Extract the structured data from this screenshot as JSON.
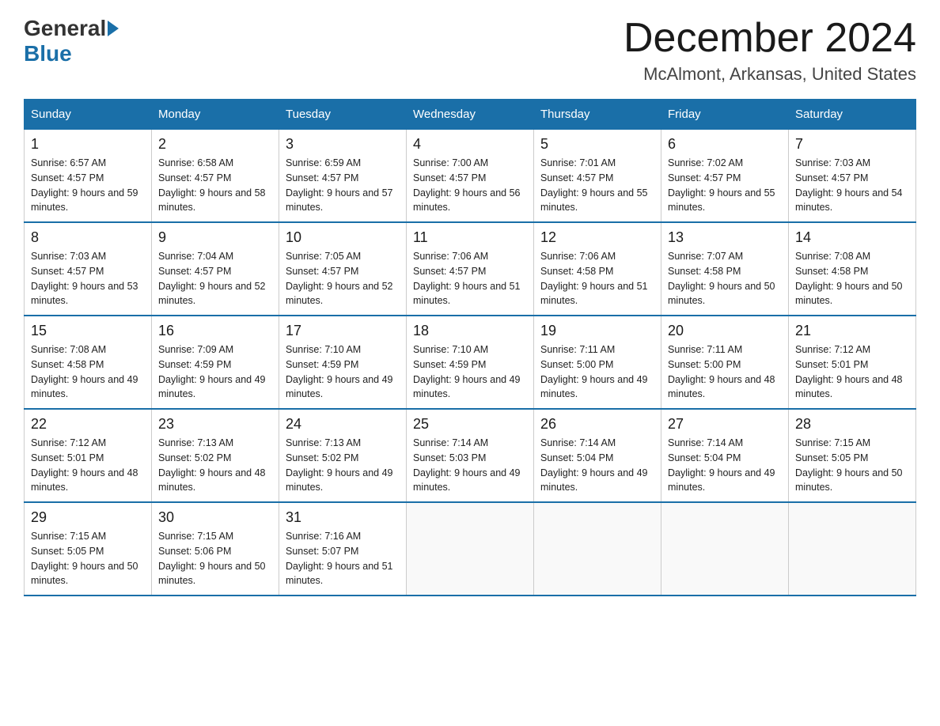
{
  "header": {
    "logo_general": "General",
    "logo_blue": "Blue",
    "calendar_title": "December 2024",
    "calendar_subtitle": "McAlmont, Arkansas, United States"
  },
  "weekdays": [
    "Sunday",
    "Monday",
    "Tuesday",
    "Wednesday",
    "Thursday",
    "Friday",
    "Saturday"
  ],
  "weeks": [
    [
      {
        "day": "1",
        "sunrise": "6:57 AM",
        "sunset": "4:57 PM",
        "daylight": "9 hours and 59 minutes."
      },
      {
        "day": "2",
        "sunrise": "6:58 AM",
        "sunset": "4:57 PM",
        "daylight": "9 hours and 58 minutes."
      },
      {
        "day": "3",
        "sunrise": "6:59 AM",
        "sunset": "4:57 PM",
        "daylight": "9 hours and 57 minutes."
      },
      {
        "day": "4",
        "sunrise": "7:00 AM",
        "sunset": "4:57 PM",
        "daylight": "9 hours and 56 minutes."
      },
      {
        "day": "5",
        "sunrise": "7:01 AM",
        "sunset": "4:57 PM",
        "daylight": "9 hours and 55 minutes."
      },
      {
        "day": "6",
        "sunrise": "7:02 AM",
        "sunset": "4:57 PM",
        "daylight": "9 hours and 55 minutes."
      },
      {
        "day": "7",
        "sunrise": "7:03 AM",
        "sunset": "4:57 PM",
        "daylight": "9 hours and 54 minutes."
      }
    ],
    [
      {
        "day": "8",
        "sunrise": "7:03 AM",
        "sunset": "4:57 PM",
        "daylight": "9 hours and 53 minutes."
      },
      {
        "day": "9",
        "sunrise": "7:04 AM",
        "sunset": "4:57 PM",
        "daylight": "9 hours and 52 minutes."
      },
      {
        "day": "10",
        "sunrise": "7:05 AM",
        "sunset": "4:57 PM",
        "daylight": "9 hours and 52 minutes."
      },
      {
        "day": "11",
        "sunrise": "7:06 AM",
        "sunset": "4:57 PM",
        "daylight": "9 hours and 51 minutes."
      },
      {
        "day": "12",
        "sunrise": "7:06 AM",
        "sunset": "4:58 PM",
        "daylight": "9 hours and 51 minutes."
      },
      {
        "day": "13",
        "sunrise": "7:07 AM",
        "sunset": "4:58 PM",
        "daylight": "9 hours and 50 minutes."
      },
      {
        "day": "14",
        "sunrise": "7:08 AM",
        "sunset": "4:58 PM",
        "daylight": "9 hours and 50 minutes."
      }
    ],
    [
      {
        "day": "15",
        "sunrise": "7:08 AM",
        "sunset": "4:58 PM",
        "daylight": "9 hours and 49 minutes."
      },
      {
        "day": "16",
        "sunrise": "7:09 AM",
        "sunset": "4:59 PM",
        "daylight": "9 hours and 49 minutes."
      },
      {
        "day": "17",
        "sunrise": "7:10 AM",
        "sunset": "4:59 PM",
        "daylight": "9 hours and 49 minutes."
      },
      {
        "day": "18",
        "sunrise": "7:10 AM",
        "sunset": "4:59 PM",
        "daylight": "9 hours and 49 minutes."
      },
      {
        "day": "19",
        "sunrise": "7:11 AM",
        "sunset": "5:00 PM",
        "daylight": "9 hours and 49 minutes."
      },
      {
        "day": "20",
        "sunrise": "7:11 AM",
        "sunset": "5:00 PM",
        "daylight": "9 hours and 48 minutes."
      },
      {
        "day": "21",
        "sunrise": "7:12 AM",
        "sunset": "5:01 PM",
        "daylight": "9 hours and 48 minutes."
      }
    ],
    [
      {
        "day": "22",
        "sunrise": "7:12 AM",
        "sunset": "5:01 PM",
        "daylight": "9 hours and 48 minutes."
      },
      {
        "day": "23",
        "sunrise": "7:13 AM",
        "sunset": "5:02 PM",
        "daylight": "9 hours and 48 minutes."
      },
      {
        "day": "24",
        "sunrise": "7:13 AM",
        "sunset": "5:02 PM",
        "daylight": "9 hours and 49 minutes."
      },
      {
        "day": "25",
        "sunrise": "7:14 AM",
        "sunset": "5:03 PM",
        "daylight": "9 hours and 49 minutes."
      },
      {
        "day": "26",
        "sunrise": "7:14 AM",
        "sunset": "5:04 PM",
        "daylight": "9 hours and 49 minutes."
      },
      {
        "day": "27",
        "sunrise": "7:14 AM",
        "sunset": "5:04 PM",
        "daylight": "9 hours and 49 minutes."
      },
      {
        "day": "28",
        "sunrise": "7:15 AM",
        "sunset": "5:05 PM",
        "daylight": "9 hours and 50 minutes."
      }
    ],
    [
      {
        "day": "29",
        "sunrise": "7:15 AM",
        "sunset": "5:05 PM",
        "daylight": "9 hours and 50 minutes."
      },
      {
        "day": "30",
        "sunrise": "7:15 AM",
        "sunset": "5:06 PM",
        "daylight": "9 hours and 50 minutes."
      },
      {
        "day": "31",
        "sunrise": "7:16 AM",
        "sunset": "5:07 PM",
        "daylight": "9 hours and 51 minutes."
      },
      null,
      null,
      null,
      null
    ]
  ]
}
